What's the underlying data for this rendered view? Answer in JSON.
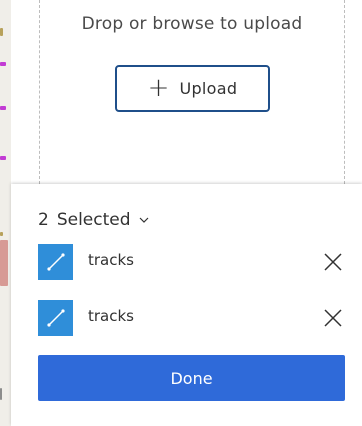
{
  "upload": {
    "prompt": "Drop or browse to upload",
    "button_plus": "+",
    "button_label": "Upload"
  },
  "selection": {
    "count": "2",
    "label": "Selected",
    "items": [
      {
        "name": "tracks",
        "icon": "line-layer-icon"
      },
      {
        "name": "tracks",
        "icon": "line-layer-icon"
      }
    ],
    "remove_icon": "close-icon",
    "done_label": "Done"
  },
  "colors": {
    "accent": "#2f6ad9",
    "layer_icon_bg": "#2f8ed9",
    "upload_border": "#1f4f8a"
  }
}
